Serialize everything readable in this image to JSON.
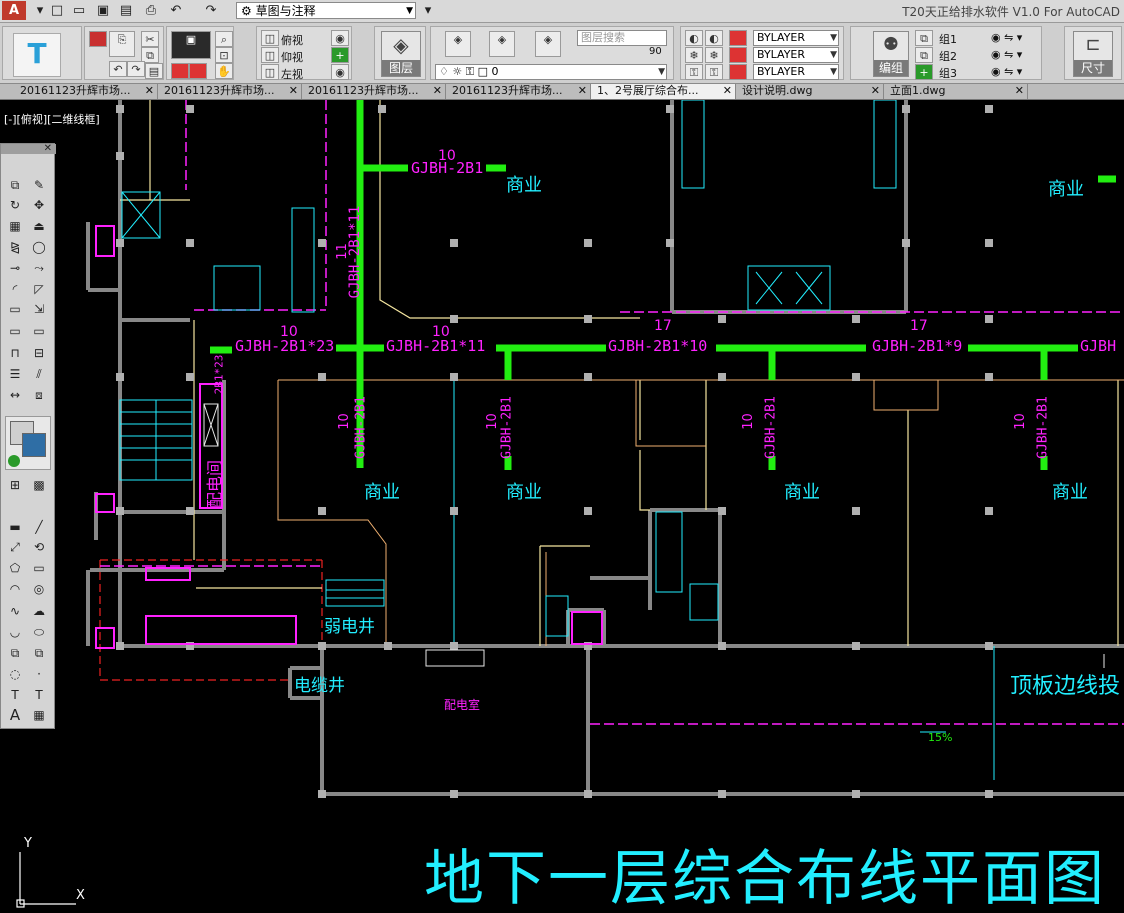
{
  "app": {
    "logo_glyph": "A",
    "title": "T20天正给排水软件 V1.0 For AutoCAD",
    "workspace": "草图与注释"
  },
  "quick_access": [
    "new-icon",
    "open-icon",
    "save-icon",
    "saveas-icon",
    "print-icon",
    "undo-icon",
    "redo-icon"
  ],
  "ribbon": {
    "views": [
      "俯视",
      "仰视",
      "左视"
    ],
    "layer_search_placeholder": "图层搜索",
    "layer_transparency": "90",
    "layer_current": "0",
    "layer_button_label": "图层",
    "props": [
      "BYLAYER",
      "BYLAYER",
      "BYLAYER"
    ],
    "group_button_label": "编组",
    "groups": [
      "组1",
      "组2",
      "组3"
    ],
    "dimension_button_label": "尺寸"
  },
  "tabs": [
    {
      "label": "20161123升辉市场...",
      "active": false
    },
    {
      "label": "20161123升辉市场...",
      "active": false
    },
    {
      "label": "20161123升辉市场...",
      "active": false
    },
    {
      "label": "20161123升辉市场...",
      "active": false
    },
    {
      "label": "1、2号展厅综合布...",
      "active": true
    },
    {
      "label": "设计说明.dwg",
      "active": false
    },
    {
      "label": "立面1.dwg",
      "active": false
    }
  ],
  "viewport_label": "[-][俯视][二维线框]",
  "drawing": {
    "title": "地下一层综合布线平面图",
    "room_label": "商业",
    "room_labels_extra": [
      "弱电井",
      "电缆井",
      "配电室",
      "配电间",
      "顶板边线投"
    ],
    "slope": "15%",
    "cables_h": [
      {
        "num": "10",
        "text": "GJBH-2B1"
      },
      {
        "num": "10",
        "text": "GJBH-2B1*23"
      },
      {
        "num": "10",
        "text": "GJBH-2B1*11"
      },
      {
        "num": "17",
        "text": "GJBH-2B1*10"
      },
      {
        "num": "17",
        "text": "GJBH-2B1*9"
      },
      {
        "num": "",
        "text": "GJBH"
      }
    ],
    "cables_v": [
      {
        "num": "11",
        "text": "GJBH-2B1*11"
      },
      {
        "num": "10",
        "text": "GJBH-2B1"
      },
      {
        "num": "10",
        "text": "GJBH-2B1"
      },
      {
        "num": "10",
        "text": "GJBH-2B1"
      },
      {
        "num": "10",
        "text": "GJBH-2B1"
      },
      {
        "num": "",
        "text": "2B1*23"
      }
    ]
  },
  "ucs": {
    "x": "X",
    "y": "Y"
  },
  "colors": {
    "cable": "#22ee11",
    "text_magenta": "#ff22ff",
    "text_cyan": "#22eeff",
    "wall": "#888888",
    "column": "#b0b0b0",
    "line_yellow": "#f5e6a0",
    "line_tan": "#f0b070",
    "red_dashed": "#ee2222"
  }
}
